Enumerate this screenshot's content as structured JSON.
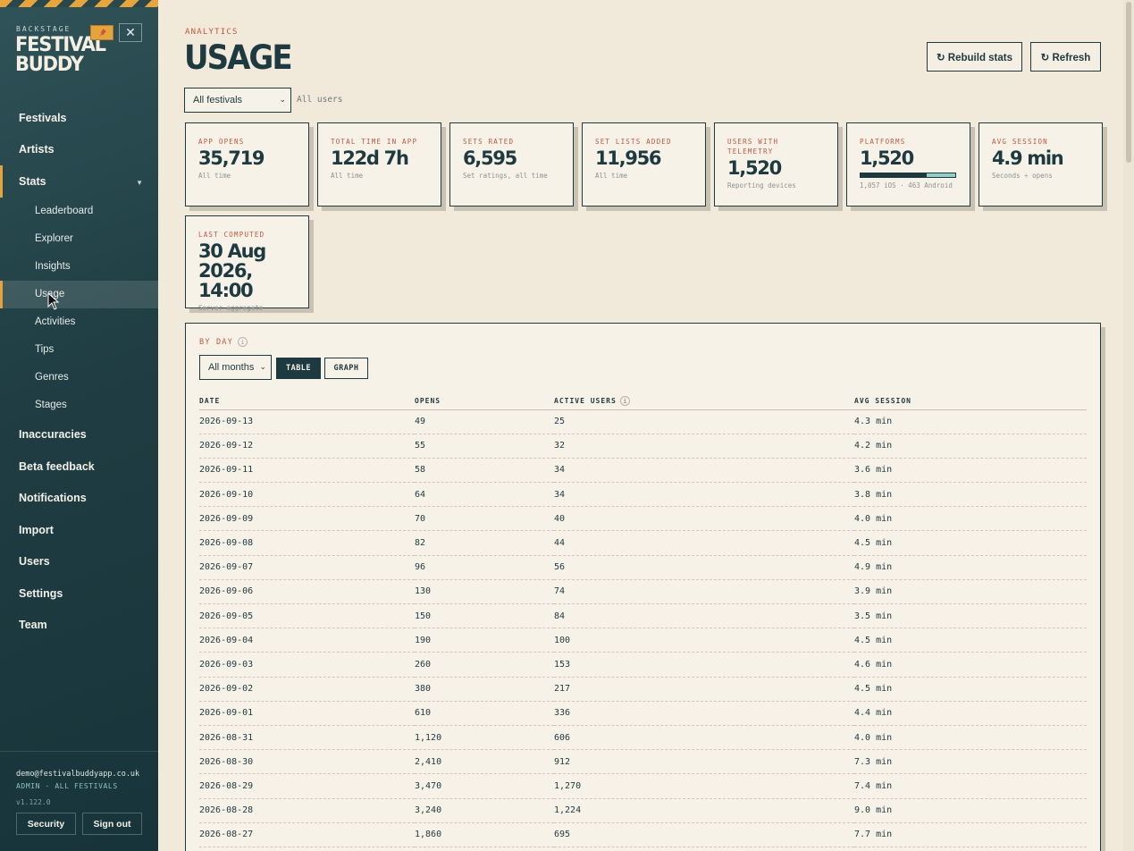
{
  "sidebar": {
    "brand_kicker": "BACKSTAGE",
    "brand_line1": "FESTIVAL",
    "brand_line2": "BUDDY",
    "pin_icon": "pin-icon",
    "close_icon": "close-icon",
    "nav_top": [
      {
        "label": "Festivals"
      },
      {
        "label": "Artists"
      }
    ],
    "stats_label": "Stats",
    "stats_sub": [
      {
        "label": "Leaderboard"
      },
      {
        "label": "Explorer"
      },
      {
        "label": "Insights"
      },
      {
        "label": "Usage",
        "active": true
      },
      {
        "label": "Activities"
      },
      {
        "label": "Tips"
      },
      {
        "label": "Genres"
      },
      {
        "label": "Stages"
      }
    ],
    "nav_bottom": [
      {
        "label": "Inaccuracies"
      },
      {
        "label": "Beta feedback"
      },
      {
        "label": "Notifications"
      },
      {
        "label": "Import"
      },
      {
        "label": "Users"
      },
      {
        "label": "Settings"
      },
      {
        "label": "Team"
      }
    ],
    "footer": {
      "email": "demo@festivalbuddyapp.co.uk",
      "role": "ADMIN · ALL FESTIVALS",
      "version": "v1.122.0",
      "security_label": "Security",
      "signout_label": "Sign out"
    }
  },
  "header": {
    "kicker": "ANALYTICS",
    "title": "USAGE",
    "rebuild_label": "↻ Rebuild stats",
    "refresh_label": "↻ Refresh"
  },
  "filters": {
    "festival_selected": "All festivals",
    "users_note": "All users"
  },
  "cards": [
    {
      "label": "APP OPENS",
      "value": "35,719",
      "sub": "All time"
    },
    {
      "label": "TOTAL TIME IN APP",
      "value": "122d 7h",
      "sub": "All time"
    },
    {
      "label": "SETS RATED",
      "value": "6,595",
      "sub": "Set ratings, all time"
    },
    {
      "label": "SET LISTS ADDED",
      "value": "11,956",
      "sub": "All time"
    },
    {
      "label": "USERS WITH TELEMETRY",
      "value": "1,520",
      "sub": "Reporting devices"
    },
    {
      "label": "PLATFORMS",
      "value": "1,520",
      "sub": "1,057 iOS · 463 Android",
      "ios_fraction": 0.695
    },
    {
      "label": "AVG SESSION",
      "value": "4.9 min",
      "sub": "Seconds ÷ opens"
    },
    {
      "label": "LAST COMPUTED",
      "value": "30 Aug 2026, 14:00",
      "sub": "Server aggregate"
    }
  ],
  "by_day": {
    "title": "BY DAY",
    "month_selected": "All months",
    "table_label": "TABLE",
    "graph_label": "GRAPH",
    "columns": [
      "DATE",
      "OPENS",
      "ACTIVE USERS",
      "AVG SESSION"
    ],
    "rows": [
      [
        "2026-09-13",
        "49",
        "25",
        "4.3 min"
      ],
      [
        "2026-09-12",
        "55",
        "32",
        "4.2 min"
      ],
      [
        "2026-09-11",
        "58",
        "34",
        "3.6 min"
      ],
      [
        "2026-09-10",
        "64",
        "34",
        "3.8 min"
      ],
      [
        "2026-09-09",
        "70",
        "40",
        "4.0 min"
      ],
      [
        "2026-09-08",
        "82",
        "44",
        "4.5 min"
      ],
      [
        "2026-09-07",
        "96",
        "56",
        "4.9 min"
      ],
      [
        "2026-09-06",
        "130",
        "74",
        "3.9 min"
      ],
      [
        "2026-09-05",
        "150",
        "84",
        "3.5 min"
      ],
      [
        "2026-09-04",
        "190",
        "100",
        "4.5 min"
      ],
      [
        "2026-09-03",
        "260",
        "153",
        "4.6 min"
      ],
      [
        "2026-09-02",
        "380",
        "217",
        "4.5 min"
      ],
      [
        "2026-09-01",
        "610",
        "336",
        "4.4 min"
      ],
      [
        "2026-08-31",
        "1,120",
        "606",
        "4.0 min"
      ],
      [
        "2026-08-30",
        "2,410",
        "912",
        "7.3 min"
      ],
      [
        "2026-08-29",
        "3,470",
        "1,270",
        "7.4 min"
      ],
      [
        "2026-08-28",
        "3,240",
        "1,224",
        "9.0 min"
      ],
      [
        "2026-08-27",
        "1,860",
        "695",
        "7.7 min"
      ]
    ]
  }
}
